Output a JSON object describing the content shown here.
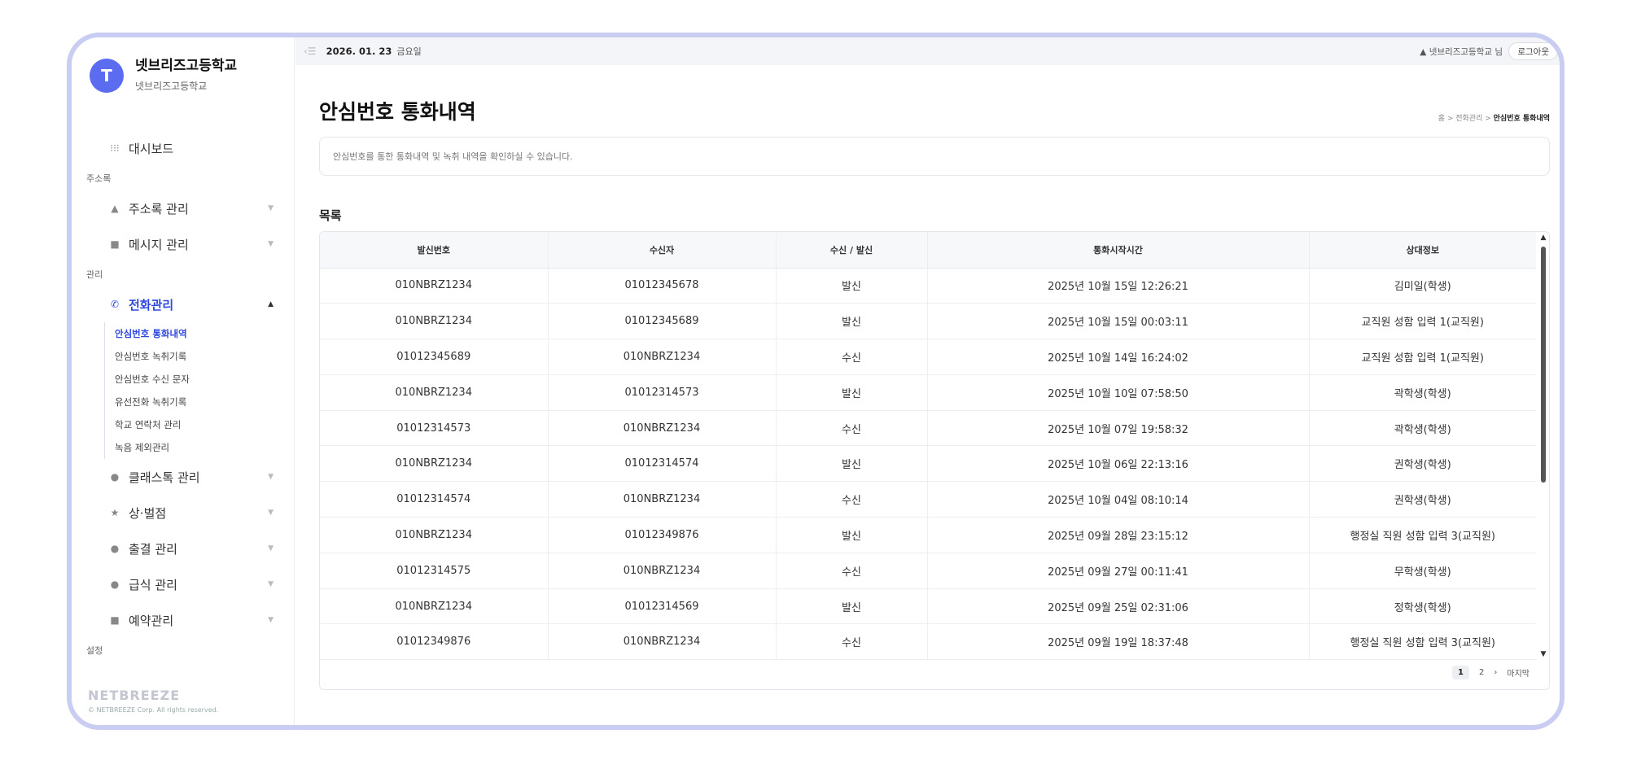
{
  "brand": {
    "avatar_letter": "T",
    "title": "넷브리즈고등학교",
    "subtitle": "넷브리즈고등학교"
  },
  "sidebar": {
    "dashboard": "대시보드",
    "section_address": "주소록",
    "address_mgmt": "주소록 관리",
    "message_mgmt": "메시지 관리",
    "section_manage": "관리",
    "phone_mgmt": "전화관리",
    "sub_items": [
      "안심번호 통화내역",
      "안심번호 녹취기록",
      "안심번호 수신 문자",
      "유선전화 녹취기록",
      "학교 연락처 관리",
      "녹음 제외관리"
    ],
    "classtalk": "클래스톡 관리",
    "reward": "상·벌점",
    "attendance": "출결 관리",
    "meal": "급식 관리",
    "reservation": "예약관리",
    "section_settings": "설정",
    "logo": "NETBREEZE",
    "copyright": "© NETBREEZE Corp. All rights reserved."
  },
  "topbar": {
    "date": "2026. 01. 23",
    "dow": "금요일",
    "user": "넷브리즈고등학교 님",
    "logout": "로그아웃"
  },
  "page": {
    "title": "안심번호 통화내역",
    "breadcrumb_home": "홈",
    "breadcrumb_mid": "전화관리",
    "breadcrumb_current": "안심번호 통화내역",
    "notice": "안심번호를 통한 통화내역 및 녹취 내역을 확인하실 수 있습니다.",
    "list_title": "목록"
  },
  "table": {
    "headers": [
      "발신번호",
      "수신자",
      "수신 / 발신",
      "통화시작시간",
      "상대정보"
    ],
    "rows": [
      [
        "010NBRZ1234",
        "01012345678",
        "발신",
        "2025년 10월 15일 12:26:21",
        "김미일(학생)"
      ],
      [
        "010NBRZ1234",
        "01012345689",
        "발신",
        "2025년 10월 15일 00:03:11",
        "교직원 성함 입력 1(교직원)"
      ],
      [
        "01012345689",
        "010NBRZ1234",
        "수신",
        "2025년 10월 14일 16:24:02",
        "교직원 성함 입력 1(교직원)"
      ],
      [
        "010NBRZ1234",
        "01012314573",
        "발신",
        "2025년 10월 10일 07:58:50",
        "곽학생(학생)"
      ],
      [
        "01012314573",
        "010NBRZ1234",
        "수신",
        "2025년 10월 07일 19:58:32",
        "곽학생(학생)"
      ],
      [
        "010NBRZ1234",
        "01012314574",
        "발신",
        "2025년 10월 06일 22:13:16",
        "권학생(학생)"
      ],
      [
        "01012314574",
        "010NBRZ1234",
        "수신",
        "2025년 10월 04일 08:10:14",
        "권학생(학생)"
      ],
      [
        "010NBRZ1234",
        "01012349876",
        "발신",
        "2025년 09월 28일 23:15:12",
        "행정실 직원 성함 입력 3(교직원)"
      ],
      [
        "01012314575",
        "010NBRZ1234",
        "수신",
        "2025년 09월 27일 00:11:41",
        "무학생(학생)"
      ],
      [
        "010NBRZ1234",
        "01012314569",
        "발신",
        "2025년 09월 25일 02:31:06",
        "정학생(학생)"
      ],
      [
        "01012349876",
        "010NBRZ1234",
        "수신",
        "2025년 09월 19일 18:37:48",
        "행정실 직원 성함 입력 3(교직원)"
      ]
    ]
  },
  "pager": {
    "pages": [
      "1",
      "2"
    ],
    "next": "›",
    "last": "마지막"
  },
  "colors": {
    "accent": "#2f48e0",
    "frame": "#c9cdf2",
    "avatar": "#5b6cf0"
  }
}
